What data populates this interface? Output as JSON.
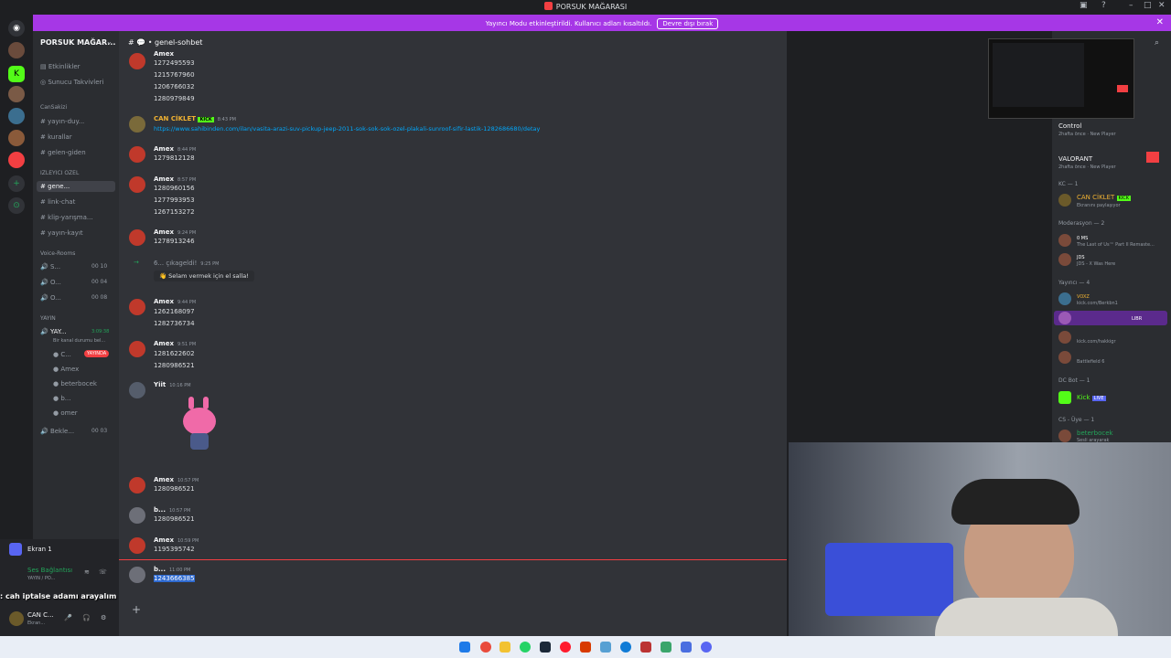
{
  "window": {
    "title": "PORSUK MAĞARASI"
  },
  "banner": {
    "text": "Yayıncı Modu etkinleştirildi. Kullanıcı adları kısaltıldı.",
    "button": "Devre dışı bırak"
  },
  "server": {
    "name": "PORSUK MAĞAR...",
    "top_items": [
      "Etkinlikler",
      "Sunucu Takvivleri"
    ],
    "categories": [
      {
        "name": "CanSakizi",
        "channels": [
          "yayın-duy...",
          "kurallar",
          "gelen-giden"
        ]
      },
      {
        "name": "IZLEYICI OZEL",
        "channels": [
          "gene...",
          "link-chat",
          "klip-yarışma...",
          "yayın-kayıt"
        ]
      },
      {
        "name": "Voice-Rooms",
        "channels": [
          "S...",
          "O...",
          "O..."
        ]
      },
      {
        "name": "YAYIN",
        "channels": [
          "YAY..."
        ]
      }
    ],
    "voice_counts": [
      "00 10",
      "00 04",
      "00 08"
    ],
    "yayin_time": "3:09:38",
    "yayin_desc": "Bir kanal durumu bel...",
    "voice_users": [
      "C...",
      "Amex",
      "beterbocek",
      "b...",
      "omer"
    ],
    "live_badge": "YAYINDA",
    "bekle": "Bekle...",
    "bekle_count": "00 03"
  },
  "user_panel": {
    "screen": "Ekran 1",
    "voice_status": "Ses Bağlantısı",
    "voice_sub": "YAYIN / PO...",
    "user_name": "CAN C...",
    "user_status": "Ekran..."
  },
  "chat": {
    "channel": "genel-sohbet",
    "messages": [
      {
        "user": "Amex",
        "time": "",
        "lines": [
          "1272495593",
          "1215767960",
          "1206766032",
          "1280979849"
        ]
      },
      {
        "user": "CAN CİKLET",
        "badge": "KICK",
        "time": "8:43 PM",
        "lines": [
          "https://www.sahibinden.com/ilan/vasita-arazi-suv-pickup-jeep-2011-sok-sok-sok-ozel-plakali-sunroof-sifir-lastik-1282686680/detay"
        ]
      },
      {
        "user": "Amex",
        "time": "8:44 PM",
        "lines": [
          "1279812128"
        ]
      },
      {
        "user": "Amex",
        "time": "8:57 PM",
        "lines": [
          "1280960156",
          "1277993953",
          "1267153272"
        ]
      },
      {
        "user": "Amex",
        "time": "9:24 PM",
        "lines": [
          "1278913246"
        ]
      },
      {
        "user": "6...",
        "time": "9:25 PM",
        "lines": [
          "çıkageldi!"
        ],
        "wave": "Selam vermek için el salla!"
      },
      {
        "user": "Amex",
        "time": "9:44 PM",
        "lines": [
          "1262168097",
          "1282736734"
        ]
      },
      {
        "user": "Amex",
        "time": "9:51 PM",
        "lines": [
          "1281622602",
          "1280986521"
        ]
      },
      {
        "user": "Yiit",
        "time": "10:16 PM",
        "lines": []
      },
      {
        "user": "Amex",
        "time": "10:57 PM",
        "lines": [
          "1280986521"
        ]
      },
      {
        "user": "b...",
        "time": "10:57 PM",
        "lines": [
          "1280986521"
        ]
      },
      {
        "user": "Amex",
        "time": "10:59 PM",
        "lines": [
          "1195395742"
        ]
      },
      {
        "user": "b...",
        "time": "11:00 PM",
        "lines": [
          "1243666385"
        ]
      }
    ]
  },
  "overlay": {
    "name": "",
    "text": ": cah iptalse adamı arayalım"
  },
  "members": {
    "activity1": "Control",
    "activity1_sub": "2haftа önce",
    "new_player": "New Player",
    "activity2": "VALORANT",
    "groups": [
      {
        "label": "KC — 1",
        "members": [
          "CAN CİKLET"
        ]
      },
      {
        "label": "Moderasyon — 2",
        "members": [
          "",
          ""
        ]
      },
      {
        "label": "Yayıncı — 4",
        "members": [
          "",
          "",
          "",
          ""
        ]
      },
      {
        "label": "DC Bot — 1",
        "members": [
          "Kick"
        ]
      },
      {
        "label": "CS - Üye — 1",
        "members": [
          "beterbocek"
        ]
      }
    ],
    "sub_texts": [
      "Ekranını paylaşıyor",
      "The Last of Us™ Part II Remaste...",
      "JDS - X Was Here",
      "kick.com/Berkbn1",
      "kick.com/hakkigr",
      "Battlefield 6",
      "Sesli arayarak"
    ],
    "badges": [
      "0 MS",
      "JDS",
      "VOXZ",
      "LIBR",
      "LIVE"
    ]
  },
  "colors": {
    "banner": "#a637e6",
    "accent": "#5865f2",
    "red": "#f23f42",
    "link": "#00a8fc",
    "kick": "#53fc18"
  }
}
